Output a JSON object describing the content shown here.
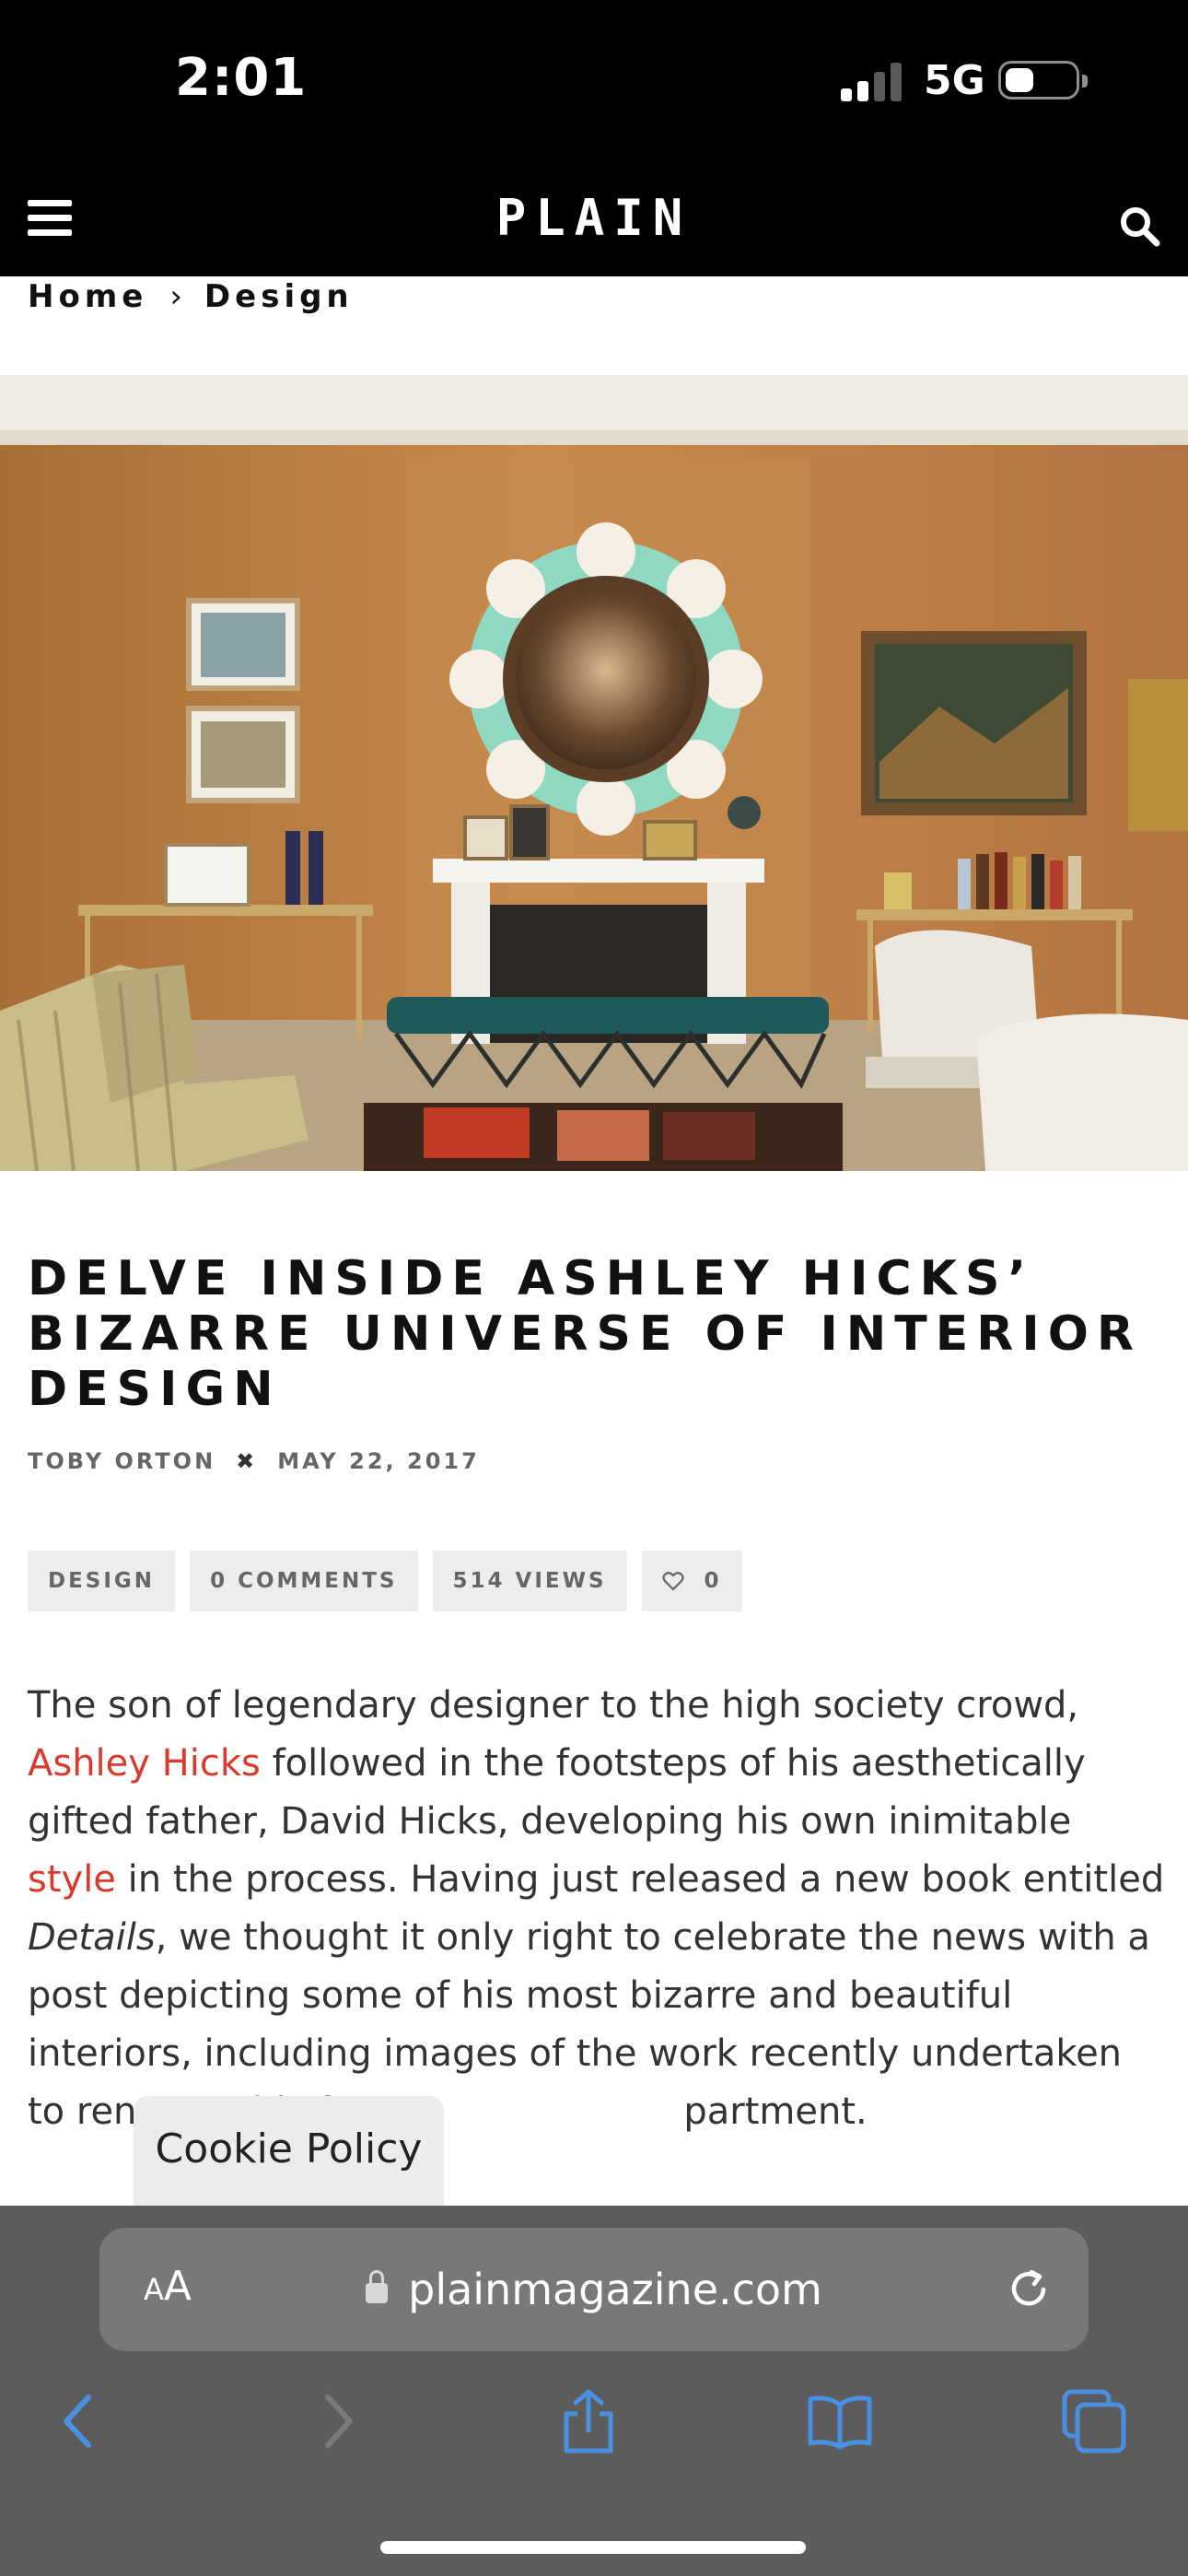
{
  "status_bar": {
    "time": "2:01",
    "network": "5G",
    "signal_bars": 2,
    "battery_level": 0.35,
    "colors": {
      "background": "#000000",
      "text": "#ffffff"
    }
  },
  "site_header": {
    "logo_text": "PLAIN",
    "menu_icon": "hamburger-menu-icon",
    "search_icon": "search-icon"
  },
  "breadcrumb": {
    "items": [
      "Home",
      "Design"
    ],
    "separator": "›"
  },
  "hero": {
    "alt": "Living room interior with sunflower mirror above fireplace"
  },
  "article": {
    "title": "DELVE INSIDE ASHLEY HICKS’ BIZARRE UNIVERSE OF INTERIOR DESIGN",
    "author": "TOBY ORTON",
    "meta_separator": "✖",
    "date": "MAY 22, 2017",
    "tags": {
      "category": "DESIGN",
      "comments": "0 COMMENTS",
      "views": "514 VIEWS",
      "likes": "0"
    },
    "body": {
      "p1": "The son of legendary designer to the high society crowd,",
      "link1": "Ashley Hicks",
      "p2": " followed in the footsteps of his aesthetically gifted father, David Hicks, developing his own inimitable ",
      "link2": "style",
      "p3": " in the process. Having just released a new book entitled ",
      "italic": "Details",
      "p4": ", we thought it only right to celebrate the news with a post depicting some of his most bizarre and beautiful interiors, including images of the work recently undertaken to renovate his fat",
      "p5": "partment."
    },
    "link_color": "#d93a2b"
  },
  "cookie_tab": {
    "label": "Cookie Policy"
  },
  "browser": {
    "text_size_label": "AA",
    "url": "plainmagazine.com",
    "icons": [
      "back-icon",
      "forward-icon",
      "share-icon",
      "bookmarks-icon",
      "tabs-icon"
    ],
    "accent": "#4a90e2"
  }
}
